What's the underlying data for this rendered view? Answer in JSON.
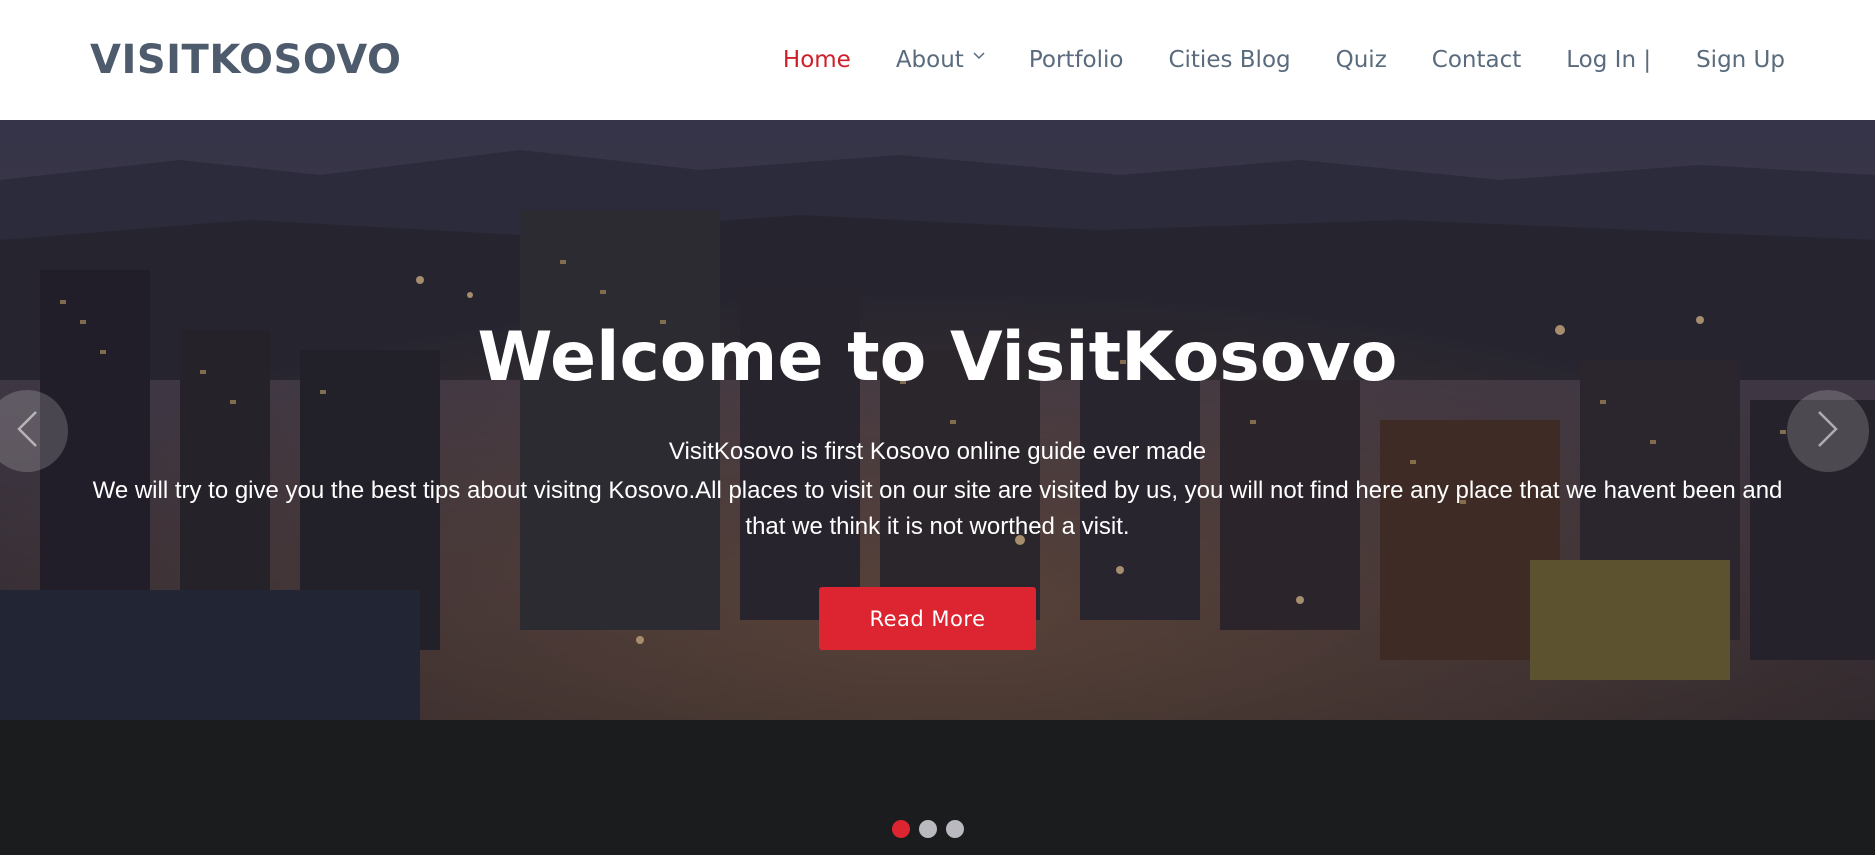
{
  "brand": {
    "logo": "VISITKOSOVO"
  },
  "nav": {
    "items": [
      {
        "label": "Home",
        "active": true
      },
      {
        "label": "About",
        "has_dropdown": true
      },
      {
        "label": "Portfolio"
      },
      {
        "label": "Cities Blog"
      },
      {
        "label": "Quiz"
      },
      {
        "label": "Contact"
      },
      {
        "label": "Log In |"
      },
      {
        "label": "Sign Up"
      }
    ],
    "dropdown_icon": "chevron-down-icon"
  },
  "hero": {
    "title": "Welcome to VisitKosovo",
    "lead": "VisitKosovo is first Kosovo online guide ever made",
    "text": "We will try to give you the best tips about visitng Kosovo.All places to visit on our site are visited by us, you will not find here any place that we havent been and that we think it is not worthed a visit.",
    "cta_label": "Read More",
    "prev_icon": "chevron-left-icon",
    "next_icon": "chevron-right-icon",
    "slides_count": 3,
    "active_slide": 1
  },
  "colors": {
    "accent": "#dc2530",
    "nav_text": "#5a6b7d",
    "logo_text": "#4d5b6d"
  }
}
